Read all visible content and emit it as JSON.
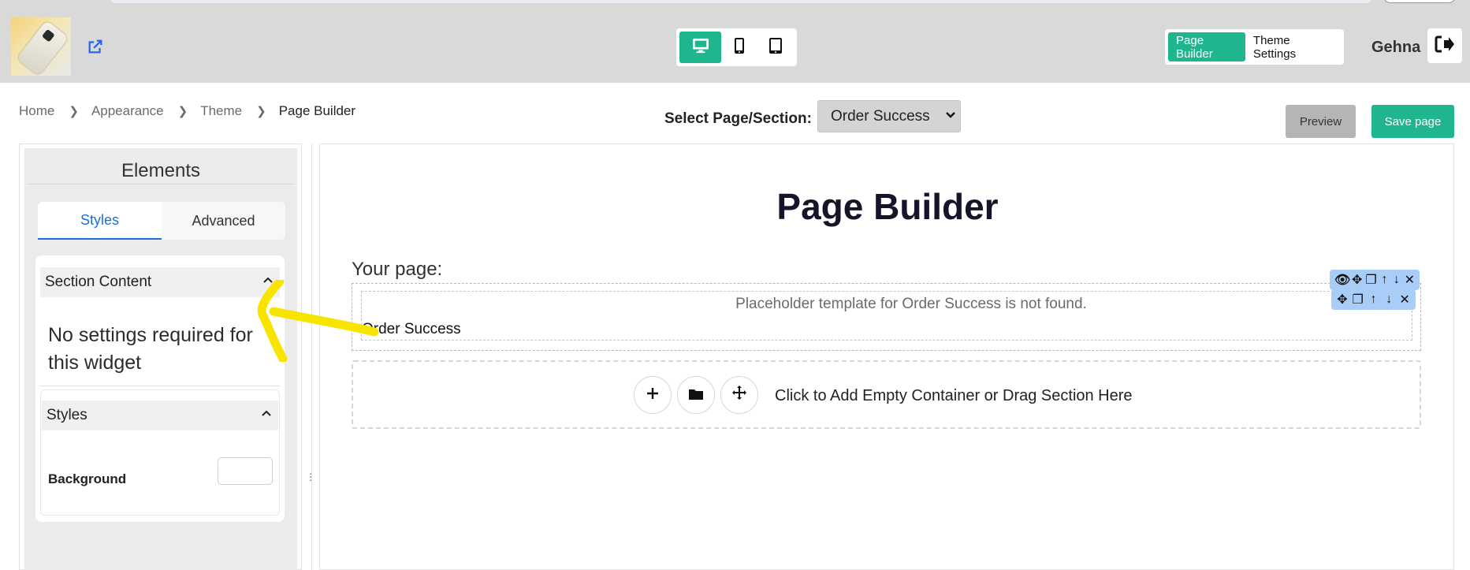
{
  "header": {
    "logo_icon": "phone-product-logo",
    "external_link_icon": "external-link-icon",
    "devices": [
      {
        "name": "desktop",
        "icon": "desktop-icon",
        "active": true
      },
      {
        "name": "mobile",
        "icon": "mobile-icon",
        "active": false
      },
      {
        "name": "tablet",
        "icon": "tablet-icon",
        "active": false
      }
    ],
    "mode_tabs": [
      {
        "label": "Page Builder",
        "active": true
      },
      {
        "label": "Theme Settings",
        "active": false
      }
    ],
    "user_name": "Gehna",
    "logout_icon": "logout-icon",
    "accent_color": "#1fb58f"
  },
  "breadcrumb": [
    "Home",
    "Appearance",
    "Theme",
    "Page Builder"
  ],
  "page_select": {
    "label": "Select Page/Section:",
    "value": "Order Success"
  },
  "actions": {
    "preview": "Preview",
    "save": "Save page"
  },
  "left_panel": {
    "title": "Elements",
    "tabs": [
      {
        "label": "Styles",
        "active": true
      },
      {
        "label": "Advanced",
        "active": false
      }
    ],
    "section_content": {
      "title": "Section Content",
      "message": "No settings required for this widget"
    },
    "styles": {
      "title": "Styles",
      "background_label": "Background",
      "background_value": "#ffffff"
    }
  },
  "canvas": {
    "heading": "Page Builder",
    "your_page_label": "Your page:",
    "placeholder_message": "Placeholder template for Order Success is not found.",
    "section_name": "Order Success",
    "toolbar_outer": [
      "eye-icon",
      "move-icon",
      "copy-icon",
      "arrow-up-icon",
      "arrow-down-icon",
      "close-icon"
    ],
    "toolbar_inner": [
      "move-icon",
      "copy-icon",
      "arrow-up-icon",
      "arrow-down-icon",
      "close-icon"
    ],
    "add_container_text": "Click to Add Empty Container or Drag Section Here",
    "add_buttons": [
      "plus-icon",
      "folder-icon",
      "move-icon"
    ]
  }
}
